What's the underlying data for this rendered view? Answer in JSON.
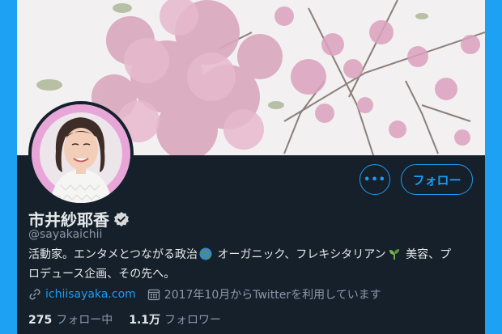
{
  "profile": {
    "name": "市井紗耶香",
    "handle": "@sayakaichii",
    "bio_line1_a": "活動家。エンタメとつながる政治",
    "bio_line1_b": " オーガニック、フレキシタリアン",
    "bio_line1_c": " 美容、プ",
    "bio_line2": "ロデュース企画、その先へ。",
    "website": "ichiisayaka.com",
    "joined": "2017年10月からTwitterを利用しています"
  },
  "actions": {
    "more_label": "•••",
    "follow_label": "フォロー"
  },
  "stats": {
    "following_count": "275",
    "following_label": "フォロー中",
    "followers_count": "1.1万",
    "followers_label": "フォロワー"
  },
  "colors": {
    "accent": "#1d9bf0",
    "background": "#15202b",
    "page_border": "#1da1f2",
    "avatar_ring": "#e8a6d8"
  },
  "icons": {
    "verified": "verified-badge-icon",
    "globe_emoji": "globe-emoji-icon",
    "seedling_emoji": "seedling-emoji-icon",
    "link": "link-icon",
    "calendar": "calendar-icon",
    "more": "more-icon"
  }
}
